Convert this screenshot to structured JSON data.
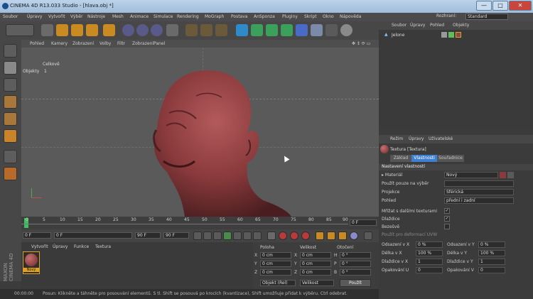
{
  "window": {
    "title": "CINEMA 4D R13.033 Studio - [hlava.obj *]",
    "min": "—",
    "max": "□",
    "close": "✕"
  },
  "menu": [
    "Soubor",
    "Úpravy",
    "Vytvořit",
    "Výběr",
    "Nástroje",
    "Mesh",
    "Animace",
    "Simulace",
    "Rendering",
    "MoGraph",
    "Postava",
    "AnSponza",
    "Pluginy",
    "Skript",
    "Okno",
    "Nápověda"
  ],
  "layout": {
    "label": "Rozhraní:",
    "value": "Standard"
  },
  "viewport": {
    "menu": [
      "Pohled",
      "Kamery",
      "Zobrazení",
      "Volby",
      "Filtr",
      "Zobrazení",
      "Panel"
    ],
    "hud": {
      "title": "Celkově",
      "objects_label": "Objekty",
      "objects_value": "1"
    }
  },
  "timeline": {
    "ticks": [
      "0",
      "5",
      "10",
      "15",
      "20",
      "25",
      "30",
      "35",
      "40",
      "45",
      "50",
      "55",
      "60",
      "65",
      "70",
      "75",
      "80",
      "85",
      "90"
    ],
    "end_field": "0 F"
  },
  "transport": {
    "start": "0 F",
    "current": "0 F",
    "range_end": "90 F",
    "end": "90 F"
  },
  "material_manager": {
    "menu": [
      "Vytvořit",
      "Úpravy",
      "Funkce",
      "Textura"
    ],
    "material_name": "Nový"
  },
  "coords": {
    "headers": {
      "pos": "Poloha",
      "size": "Velikost",
      "rot": "Otočení"
    },
    "rows": [
      {
        "a": "X",
        "av": "0 cm",
        "b": "X",
        "bv": "0 cm",
        "c": "H",
        "cv": "0 °"
      },
      {
        "a": "Y",
        "av": "0 cm",
        "b": "Y",
        "bv": "0 cm",
        "c": "P",
        "cv": "0 °"
      },
      {
        "a": "Z",
        "av": "0 cm",
        "b": "Z",
        "bv": "0 cm",
        "c": "B",
        "cv": "0 °"
      }
    ],
    "mode1": "Objekt (Rel)",
    "mode2": "Velikost",
    "apply": "Použít"
  },
  "status": {
    "time": "00:00:00",
    "text": "Posun: Klikněte a táhněte pro posouvání elementů. S tl. Shift se posouvá po krocích (kvantizace), Shift umožňuje přidat k výběru. Ctrl odebrat."
  },
  "object_manager": {
    "menu": [
      "Soubor",
      "Úpravy",
      "Pohled",
      "Objekty"
    ],
    "object": "Jelone"
  },
  "attribute_manager": {
    "menu": [
      "Režim",
      "Úpravy",
      "Uživatelské"
    ],
    "header": "Textura [Textura]",
    "tabs": [
      "Základ",
      "Vlastnosti",
      "Souřadnice"
    ],
    "section": "Nastavení vlastností",
    "props": [
      {
        "label": "▸ Materiál",
        "value": "Nový"
      },
      {
        "label": "Použít pouze na výběr",
        "value": ""
      },
      {
        "label": "Projekce",
        "value": "Sférická"
      },
      {
        "label": "Pohled",
        "value": "přední i zadní"
      }
    ],
    "checks": [
      {
        "label": "Mřížat s dalšími texturami",
        "on": true
      },
      {
        "label": "Dlaždice",
        "on": true
      },
      {
        "label": "Bezešvě",
        "on": false
      },
      {
        "label": "Použít pro deformací UVW",
        "on": false
      }
    ],
    "offsets": [
      {
        "l1": "Odsazení v X",
        "v1": "0 %",
        "l2": "Odsazení v Y",
        "v2": "0 %"
      },
      {
        "l1": "Délka v X",
        "v1": "100 %",
        "l2": "Délka v Y",
        "v2": "100 %"
      },
      {
        "l1": "Dlaždice v X",
        "v1": "1",
        "l2": "Dlaždice v Y",
        "v2": "1"
      },
      {
        "l1": "Opakování U",
        "v1": "0",
        "l2": "Opakování V",
        "v2": "0"
      }
    ]
  },
  "colors": {
    "accent": "#3f7fcf",
    "head": "#8a3a3c",
    "viewport": "#5a5a5a"
  }
}
